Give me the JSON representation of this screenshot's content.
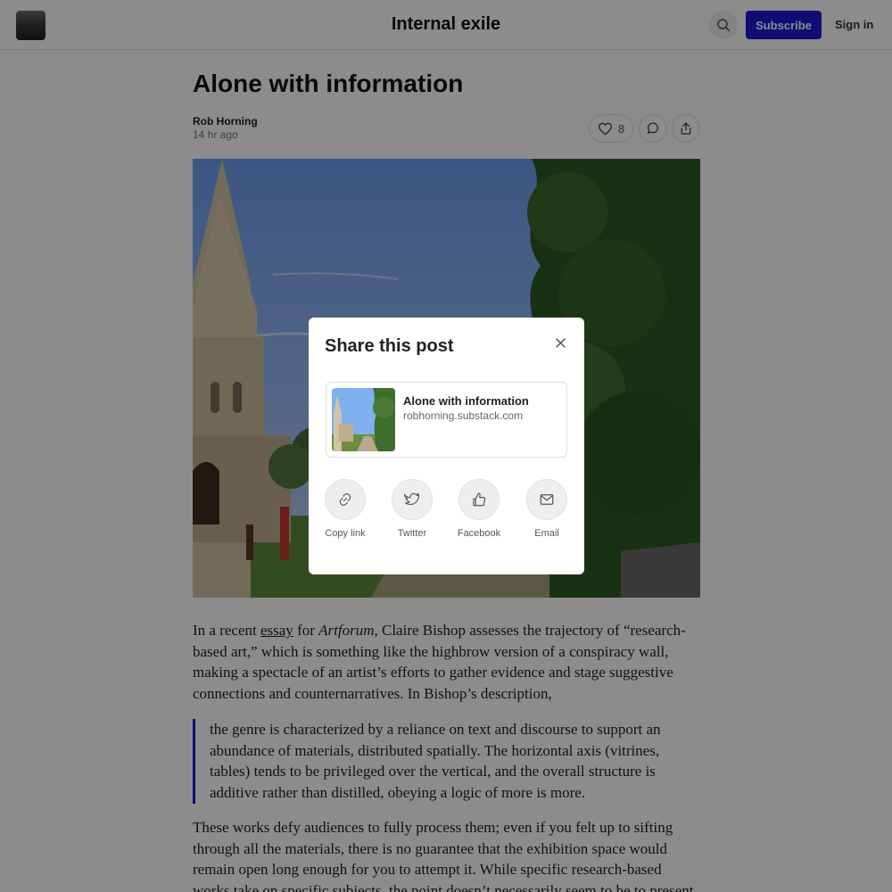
{
  "header": {
    "publication_title": "Internal exile",
    "subscribe_label": "Subscribe",
    "signin_label": "Sign in"
  },
  "post": {
    "title": "Alone with information",
    "author": "Rob Horning",
    "date": "14 hr ago",
    "like_count": "8"
  },
  "body": {
    "p1_before": "In a recent ",
    "p1_link": "essay",
    "p1_mid": " for ",
    "p1_italic": "Artforum",
    "p1_after": ", Claire Bishop assesses the trajectory of “research-based art,” which is something like the highbrow version of a conspiracy wall, making a spectacle of an artist’s efforts to gather evidence and stage suggestive connections and counternarratives. In Bishop’s description,",
    "quote": "the genre is characterized by a reliance on text and discourse to support an abundance of materials, distributed spatially. The horizontal axis (vitrines, tables) tends to be privileged over the vertical, and the overall structure is additive rather than distilled, obeying a logic of more is more.",
    "p2": "These works defy audiences to fully process them; even if you felt up to sifting through all the materials, there is no guarantee that the exhibition space would remain open long enough for you to attempt it. While specific research-based works take on specific subjects, the point doesn’t necessarily seem to be to present findings that"
  },
  "share_modal": {
    "title": "Share this post",
    "card_title": "Alone with information",
    "card_url": "robhorning.substack.com",
    "options": [
      {
        "label": "Copy link",
        "icon": "link-icon"
      },
      {
        "label": "Twitter",
        "icon": "twitter-icon"
      },
      {
        "label": "Facebook",
        "icon": "thumbs-up-icon"
      },
      {
        "label": "Email",
        "icon": "mail-icon"
      }
    ]
  },
  "colors": {
    "accent": "#1a1ad6",
    "overlay": "rgba(0,0,0,0.45)"
  }
}
